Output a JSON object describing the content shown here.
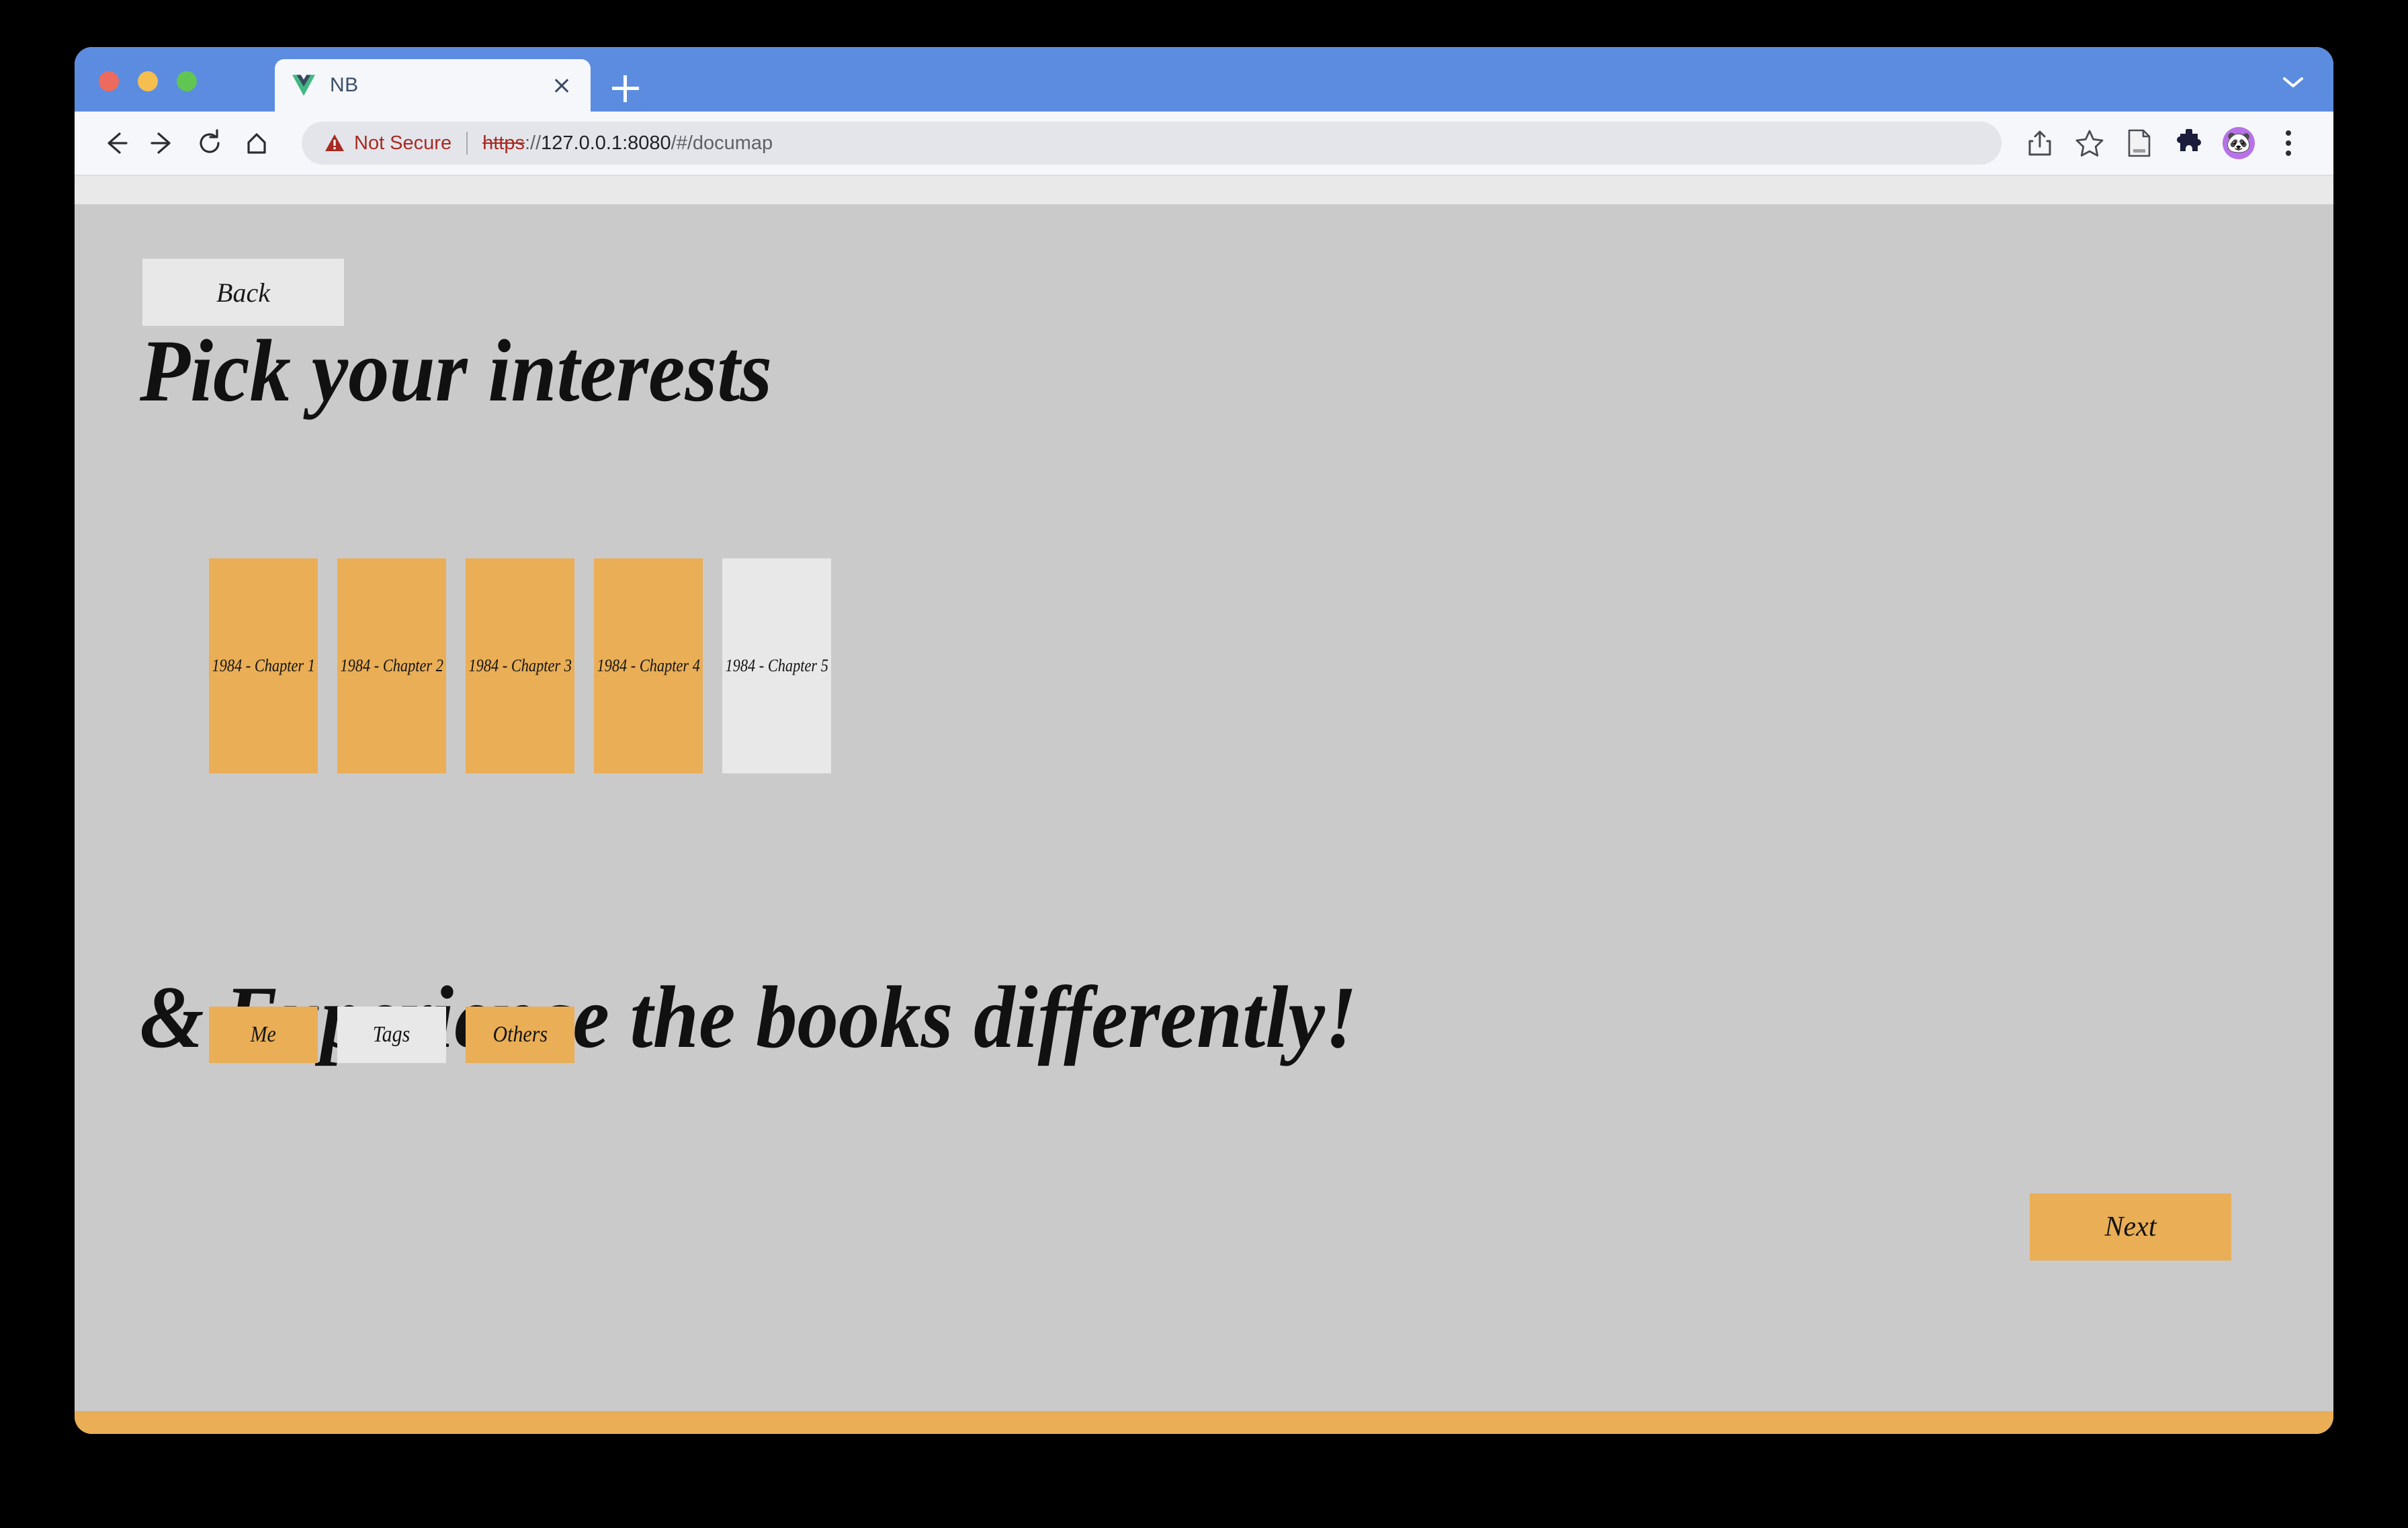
{
  "browser": {
    "tab": {
      "title": "NB",
      "favicon_icon": "vue-logo-icon",
      "close_icon": "close-icon"
    },
    "new_tab_icon": "plus-icon",
    "tab_list_icon": "chevron-down-icon",
    "traffic_lights": [
      "close-window",
      "minimize-window",
      "maximize-window"
    ],
    "nav": {
      "back_icon": "arrow-left-icon",
      "forward_icon": "arrow-right-icon",
      "reload_icon": "reload-icon",
      "home_icon": "home-icon"
    },
    "omnibox": {
      "warning_icon": "warning-triangle-icon",
      "security_label": "Not Secure",
      "url_scheme": "https",
      "url_separator": "://",
      "url_host": "127.0.0.1:8080",
      "url_path": "/#/documap",
      "full_url": "https://127.0.0.1:8080/#/documap"
    },
    "toolbar_icons": [
      "share-icon",
      "bookmark-star-icon",
      "reading-list-icon",
      "extensions-puzzle-icon",
      "profile-avatar-icon",
      "kebab-menu-icon"
    ],
    "profile_avatar_glyph": "🐼"
  },
  "colors": {
    "accent_orange": "#e9ae56",
    "page_background": "#cacaca",
    "unselected_gray": "#e8e8e8",
    "tab_strip_blue": "#5b8ce0",
    "not_secure_red": "#a72b23",
    "avatar_purple": "#b772e8"
  },
  "page": {
    "back_button_label": "Back",
    "heading_primary": "Pick your interests",
    "heading_secondary": "& Experience the books differently!",
    "next_button_label": "Next",
    "chapters": [
      {
        "label": "1984 - Chapter 1",
        "selected": true
      },
      {
        "label": "1984 - Chapter 2",
        "selected": true
      },
      {
        "label": "1984 - Chapter 3",
        "selected": true
      },
      {
        "label": "1984 - Chapter 4",
        "selected": true
      },
      {
        "label": "1984 - Chapter 5",
        "selected": false
      }
    ],
    "filters": [
      {
        "label": "Me",
        "selected": true
      },
      {
        "label": "Tags",
        "selected": false
      },
      {
        "label": "Others",
        "selected": true
      }
    ]
  }
}
